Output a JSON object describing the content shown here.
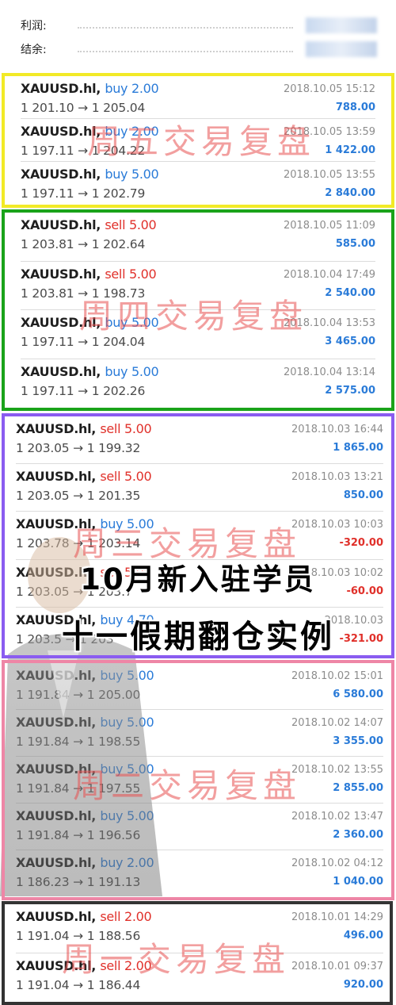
{
  "header": {
    "profit_label": "利润:",
    "balance_label": "结余:"
  },
  "groups": [
    {
      "caption": "周五交易复盘",
      "color": "#f2ea26",
      "trades": [
        {
          "symbol": "XAUUSD.hl,",
          "side": "buy",
          "lots": "2.00",
          "open": "1 201.10",
          "close": "1 205.04",
          "datetime": "2018.10.05 15:12",
          "profit": "788.00"
        },
        {
          "symbol": "XAUUSD.hl,",
          "side": "buy",
          "lots": "2.00",
          "open": "1 197.11",
          "close": "1 204.22",
          "datetime": "2018.10.05 13:59",
          "profit": "1 422.00"
        },
        {
          "symbol": "XAUUSD.hl,",
          "side": "buy",
          "lots": "5.00",
          "open": "1 197.11",
          "close": "1 202.79",
          "datetime": "2018.10.05 13:55",
          "profit": "2 840.00"
        }
      ]
    },
    {
      "caption": "周四交易复盘",
      "color": "#1aa31a",
      "trades": [
        {
          "symbol": "XAUUSD.hl,",
          "side": "sell",
          "lots": "5.00",
          "open": "1 203.81",
          "close": "1 202.64",
          "datetime": "2018.10.05 11:09",
          "profit": "585.00"
        },
        {
          "symbol": "XAUUSD.hl,",
          "side": "sell",
          "lots": "5.00",
          "open": "1 203.81",
          "close": "1 198.73",
          "datetime": "2018.10.04 17:49",
          "profit": "2 540.00"
        },
        {
          "symbol": "XAUUSD.hl,",
          "side": "buy",
          "lots": "5.00",
          "open": "1 197.11",
          "close": "1 204.04",
          "datetime": "2018.10.04 13:53",
          "profit": "3 465.00"
        },
        {
          "symbol": "XAUUSD.hl,",
          "side": "buy",
          "lots": "5.00",
          "open": "1 197.11",
          "close": "1 202.26",
          "datetime": "2018.10.04 13:14",
          "profit": "2 575.00"
        }
      ]
    },
    {
      "caption": "周三交易复盘",
      "color": "#8a5cf0",
      "trades": [
        {
          "symbol": "XAUUSD.hl,",
          "side": "sell",
          "lots": "5.00",
          "open": "1 203.05",
          "close": "1 199.32",
          "datetime": "2018.10.03 16:44",
          "profit": "1 865.00"
        },
        {
          "symbol": "XAUUSD.hl,",
          "side": "sell",
          "lots": "5.00",
          "open": "1 203.05",
          "close": "1 201.35",
          "datetime": "2018.10.03 13:21",
          "profit": "850.00"
        },
        {
          "symbol": "XAUUSD.hl,",
          "side": "buy",
          "lots": "5.00",
          "open": "1 203.78",
          "close": "1 203.14",
          "datetime": "2018.10.03 10:03",
          "profit": "-320.00"
        },
        {
          "symbol": "XAUUSD.hl,",
          "side": "sell",
          "lots": "5.00",
          "open": "1 203.05",
          "close": "1 203.7",
          "datetime": "2018.10.03 10:02",
          "profit": "-60.00"
        },
        {
          "symbol": "XAUUSD.hl,",
          "side": "buy",
          "lots": "4.70",
          "open": "1 203.5",
          "close": "1 203",
          "datetime": "2018.10.03",
          "profit": "-321.00"
        }
      ]
    },
    {
      "caption": "周二交易复盘",
      "color": "#ee86a6",
      "trades": [
        {
          "symbol": "XAUUSD.hl,",
          "side": "buy",
          "lots": "5.00",
          "open": "1 191.84",
          "close": "1 205.00",
          "datetime": "2018.10.02 15:01",
          "profit": "6 580.00"
        },
        {
          "symbol": "XAUUSD.hl,",
          "side": "buy",
          "lots": "5.00",
          "open": "1 191.84",
          "close": "1 198.55",
          "datetime": "2018.10.02 14:07",
          "profit": "3 355.00"
        },
        {
          "symbol": "XAUUSD.hl,",
          "side": "buy",
          "lots": "5.00",
          "open": "1 191.84",
          "close": "1 197.55",
          "datetime": "2018.10.02 13:55",
          "profit": "2 855.00"
        },
        {
          "symbol": "XAUUSD.hl,",
          "side": "buy",
          "lots": "5.00",
          "open": "1 191.84",
          "close": "1 196.56",
          "datetime": "2018.10.02 13:47",
          "profit": "2 360.00"
        },
        {
          "symbol": "XAUUSD.hl,",
          "side": "buy",
          "lots": "2.00",
          "open": "1 186.23",
          "close": "1 191.13",
          "datetime": "2018.10.02 04:12",
          "profit": "1 040.00"
        }
      ]
    },
    {
      "caption": "周一交易复盘",
      "color": "#333333",
      "trades": [
        {
          "symbol": "XAUUSD.hl,",
          "side": "sell",
          "lots": "2.00",
          "open": "1 191.04",
          "close": "1 188.56",
          "datetime": "2018.10.01 14:29",
          "profit": "496.00"
        },
        {
          "symbol": "XAUUSD.hl,",
          "side": "sell",
          "lots": "2.00",
          "open": "1 191.04",
          "close": "1 186.44",
          "datetime": "2018.10.01 09:37",
          "profit": "920.00"
        }
      ]
    }
  ],
  "banner": {
    "line1": "10月新入驻学员",
    "line2": "十一假期翻仓实例"
  },
  "arrow": "→"
}
